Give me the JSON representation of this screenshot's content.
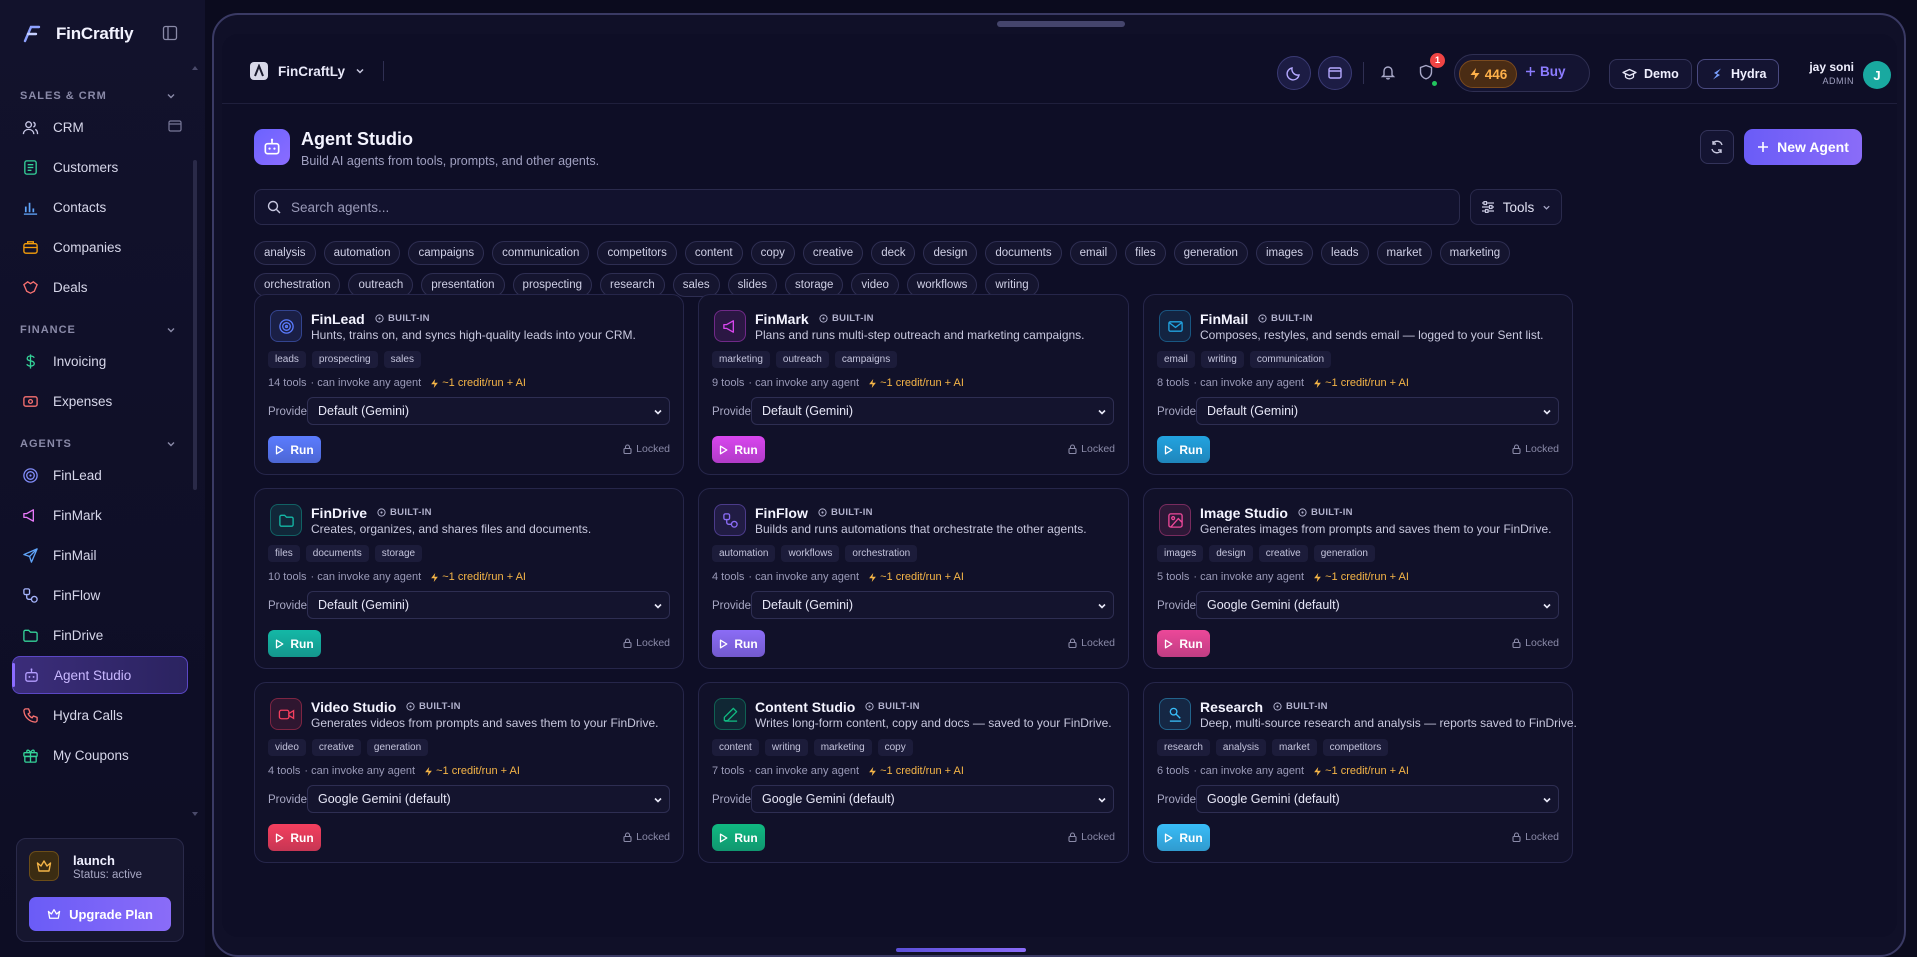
{
  "brand": {
    "name": "FinCraftly"
  },
  "sidebar": {
    "sections": [
      {
        "label": "SALES & CRM",
        "items": [
          {
            "label": "CRM",
            "icon": "users-icon"
          },
          {
            "label": "Customers",
            "icon": "customers-icon"
          },
          {
            "label": "Contacts",
            "icon": "contacts-icon"
          },
          {
            "label": "Companies",
            "icon": "companies-icon"
          },
          {
            "label": "Deals",
            "icon": "deals-icon"
          }
        ]
      },
      {
        "label": "FINANCE",
        "items": [
          {
            "label": "Invoicing",
            "icon": "dollar-icon"
          },
          {
            "label": "Expenses",
            "icon": "expenses-icon"
          }
        ]
      },
      {
        "label": "AGENTS",
        "items": [
          {
            "label": "FinLead",
            "icon": "target-icon"
          },
          {
            "label": "FinMark",
            "icon": "megaphone-icon"
          },
          {
            "label": "FinMail",
            "icon": "send-icon"
          },
          {
            "label": "FinFlow",
            "icon": "workflow-icon"
          },
          {
            "label": "FinDrive",
            "icon": "folder-icon"
          },
          {
            "label": "Agent Studio",
            "icon": "bot-icon"
          },
          {
            "label": "Hydra Calls",
            "icon": "phone-icon"
          },
          {
            "label": "My Coupons",
            "icon": "gift-icon"
          }
        ]
      }
    ],
    "plan": {
      "title": "launch",
      "status": "Status: active",
      "upgrade_label": "Upgrade Plan"
    }
  },
  "topbar": {
    "workspace": "FinCraftLy",
    "notification_count": "1",
    "credits": "446",
    "buy_label": "Buy",
    "demo_label": "Demo",
    "hydra_label": "Hydra",
    "user_name": "jay soni",
    "user_role": "ADMIN",
    "avatar_initial": "J"
  },
  "header": {
    "title": "Agent Studio",
    "subtitle": "Build AI agents from tools, prompts, and other agents.",
    "new_agent_label": "New Agent"
  },
  "search": {
    "placeholder": "Search agents...",
    "tools_label": "Tools"
  },
  "filter_tags": [
    "analysis",
    "automation",
    "campaigns",
    "communication",
    "competitors",
    "content",
    "copy",
    "creative",
    "deck",
    "design",
    "documents",
    "email",
    "files",
    "generation",
    "images",
    "leads",
    "market",
    "marketing",
    "orchestration",
    "outreach",
    "presentation",
    "prospecting",
    "research",
    "sales",
    "slides",
    "storage",
    "video",
    "workflows",
    "writing"
  ],
  "agent_common": {
    "builtin_label": "BUILT-IN",
    "invoke_text": "· can invoke any agent",
    "cost_text": "~1 credit/run + AI",
    "provider_label": "Provider",
    "run_label": "Run",
    "locked_label": "Locked"
  },
  "agents": [
    {
      "name": "FinLead",
      "description": "Hunts, trains on, and syncs high-quality leads into your CRM.",
      "tags": [
        "leads",
        "prospecting",
        "sales"
      ],
      "tools": "14 tools",
      "provider": "Default (Gemini)",
      "icon": "target-icon",
      "accent": "#5b7cff"
    },
    {
      "name": "FinMark",
      "description": "Plans and runs multi-step outreach and marketing campaigns.",
      "tags": [
        "marketing",
        "outreach",
        "campaigns"
      ],
      "tools": "9 tools",
      "provider": "Default (Gemini)",
      "icon": "megaphone-icon",
      "accent": "#d946ef"
    },
    {
      "name": "FinMail",
      "description": "Composes, restyles, and sends email — logged to your Sent list.",
      "tags": [
        "email",
        "writing",
        "communication"
      ],
      "tools": "8 tools",
      "provider": "Default (Gemini)",
      "icon": "mail-icon",
      "accent": "#22a3e0"
    },
    {
      "name": "FinDrive",
      "description": "Creates, organizes, and shares files and documents.",
      "tags": [
        "files",
        "documents",
        "storage"
      ],
      "tools": "10 tools",
      "provider": "Default (Gemini)",
      "icon": "folder-icon",
      "accent": "#14b8a6"
    },
    {
      "name": "FinFlow",
      "description": "Builds and runs automations that orchestrate the other agents.",
      "tags": [
        "automation",
        "workflows",
        "orchestration"
      ],
      "tools": "4 tools",
      "provider": "Default (Gemini)",
      "icon": "workflow-icon",
      "accent": "#8b6cf6"
    },
    {
      "name": "Image Studio",
      "description": "Generates images from prompts and saves them to your FinDrive.",
      "tags": [
        "images",
        "design",
        "creative",
        "generation"
      ],
      "tools": "5 tools",
      "provider": "Google Gemini (default)",
      "icon": "image-icon",
      "accent": "#ec4899"
    },
    {
      "name": "Video Studio",
      "description": "Generates videos from prompts and saves them to your FinDrive.",
      "tags": [
        "video",
        "creative",
        "generation"
      ],
      "tools": "4 tools",
      "provider": "Google Gemini (default)",
      "icon": "video-icon",
      "accent": "#f43f5e"
    },
    {
      "name": "Content Studio",
      "description": "Writes long-form content, copy and docs — saved to your FinDrive.",
      "tags": [
        "content",
        "writing",
        "marketing",
        "copy"
      ],
      "tools": "7 tools",
      "provider": "Google Gemini (default)",
      "icon": "pen-icon",
      "accent": "#10b981"
    },
    {
      "name": "Research",
      "description": "Deep, multi-source research and analysis — reports saved to FinDrive.",
      "tags": [
        "research",
        "analysis",
        "market",
        "competitors"
      ],
      "tools": "6 tools",
      "provider": "Google Gemini (default)",
      "icon": "research-icon",
      "accent": "#38bdf8"
    }
  ]
}
